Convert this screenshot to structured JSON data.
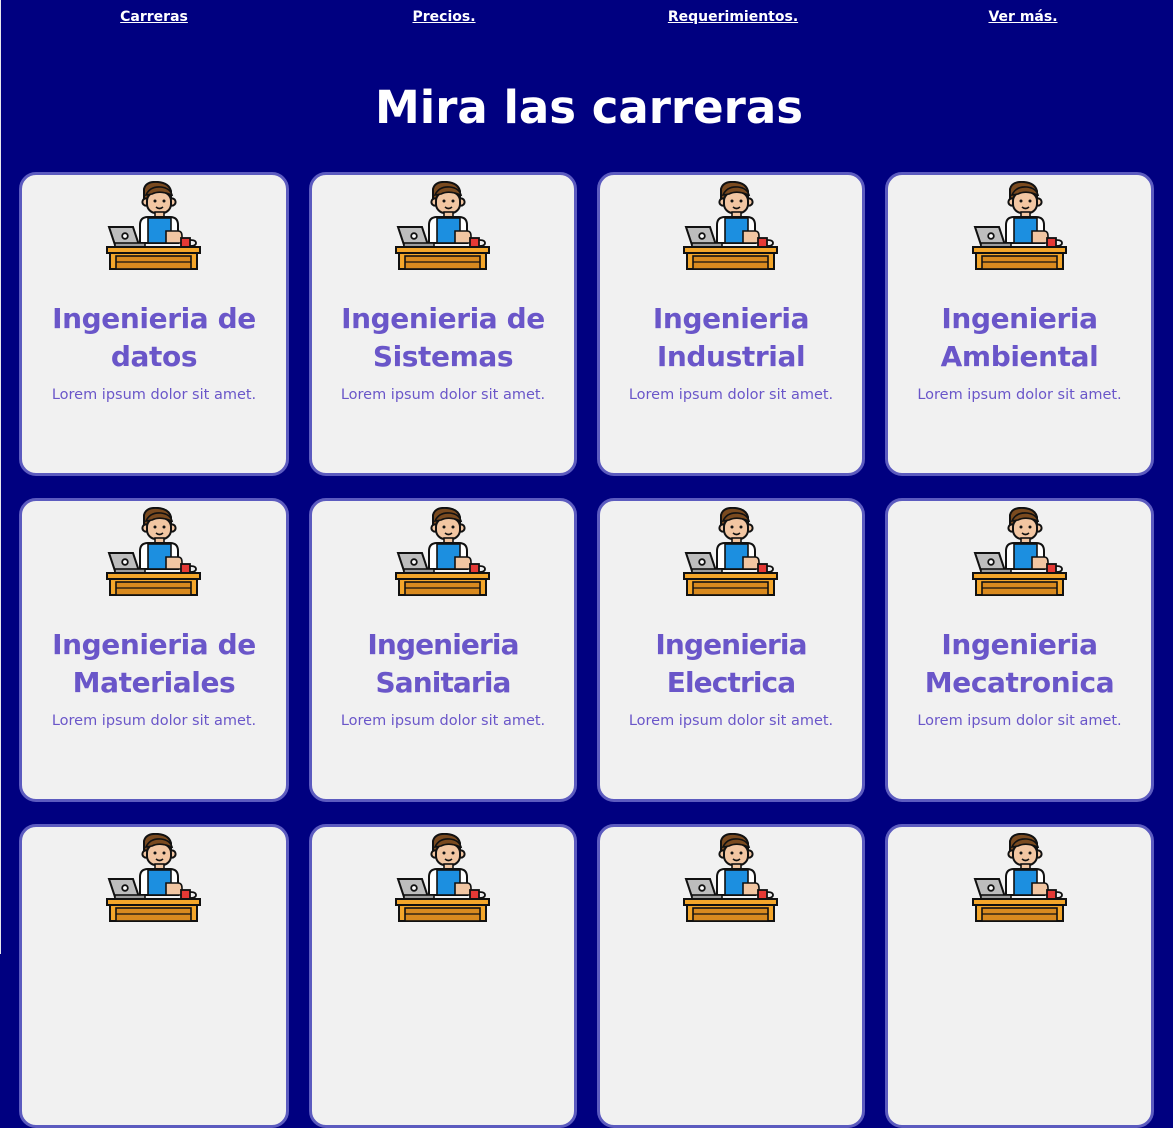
{
  "nav": {
    "items": [
      {
        "label": "Carreras"
      },
      {
        "label": "Precios."
      },
      {
        "label": "Requerimientos."
      },
      {
        "label": "Ver más."
      }
    ]
  },
  "main": {
    "title": "Mira las carreras"
  },
  "cards": [
    {
      "title": "Ingenieria de datos",
      "description": "Lorem ipsum dolor sit amet.",
      "icon": "programmer-at-desk-icon"
    },
    {
      "title": "Ingenieria de Sistemas",
      "description": "Lorem ipsum dolor sit amet.",
      "icon": "programmer-at-desk-icon"
    },
    {
      "title": "Ingenieria Industrial",
      "description": "Lorem ipsum dolor sit amet.",
      "icon": "programmer-at-desk-icon"
    },
    {
      "title": "Ingenieria Ambiental",
      "description": "Lorem ipsum dolor sit amet.",
      "icon": "programmer-at-desk-icon"
    },
    {
      "title": "Ingenieria de Materiales",
      "description": "Lorem ipsum dolor sit amet.",
      "icon": "programmer-at-desk-icon"
    },
    {
      "title": "Ingenieria Sanitaria",
      "description": "Lorem ipsum dolor sit amet.",
      "icon": "programmer-at-desk-icon"
    },
    {
      "title": "Ingenieria Electrica",
      "description": "Lorem ipsum dolor sit amet.",
      "icon": "programmer-at-desk-icon"
    },
    {
      "title": "Ingenieria Mecatronica",
      "description": "Lorem ipsum dolor sit amet.",
      "icon": "programmer-at-desk-icon"
    },
    {
      "title": "",
      "description": "",
      "icon": "programmer-at-desk-icon"
    },
    {
      "title": "",
      "description": "",
      "icon": "programmer-at-desk-icon"
    },
    {
      "title": "",
      "description": "",
      "icon": "programmer-at-desk-icon"
    },
    {
      "title": "",
      "description": "",
      "icon": "programmer-at-desk-icon"
    }
  ],
  "colors": {
    "background": "#000080",
    "card_background": "#f1f1f1",
    "card_border": "#5c5bbf",
    "card_text": "#6a56c9",
    "nav_text": "#ffffff"
  }
}
